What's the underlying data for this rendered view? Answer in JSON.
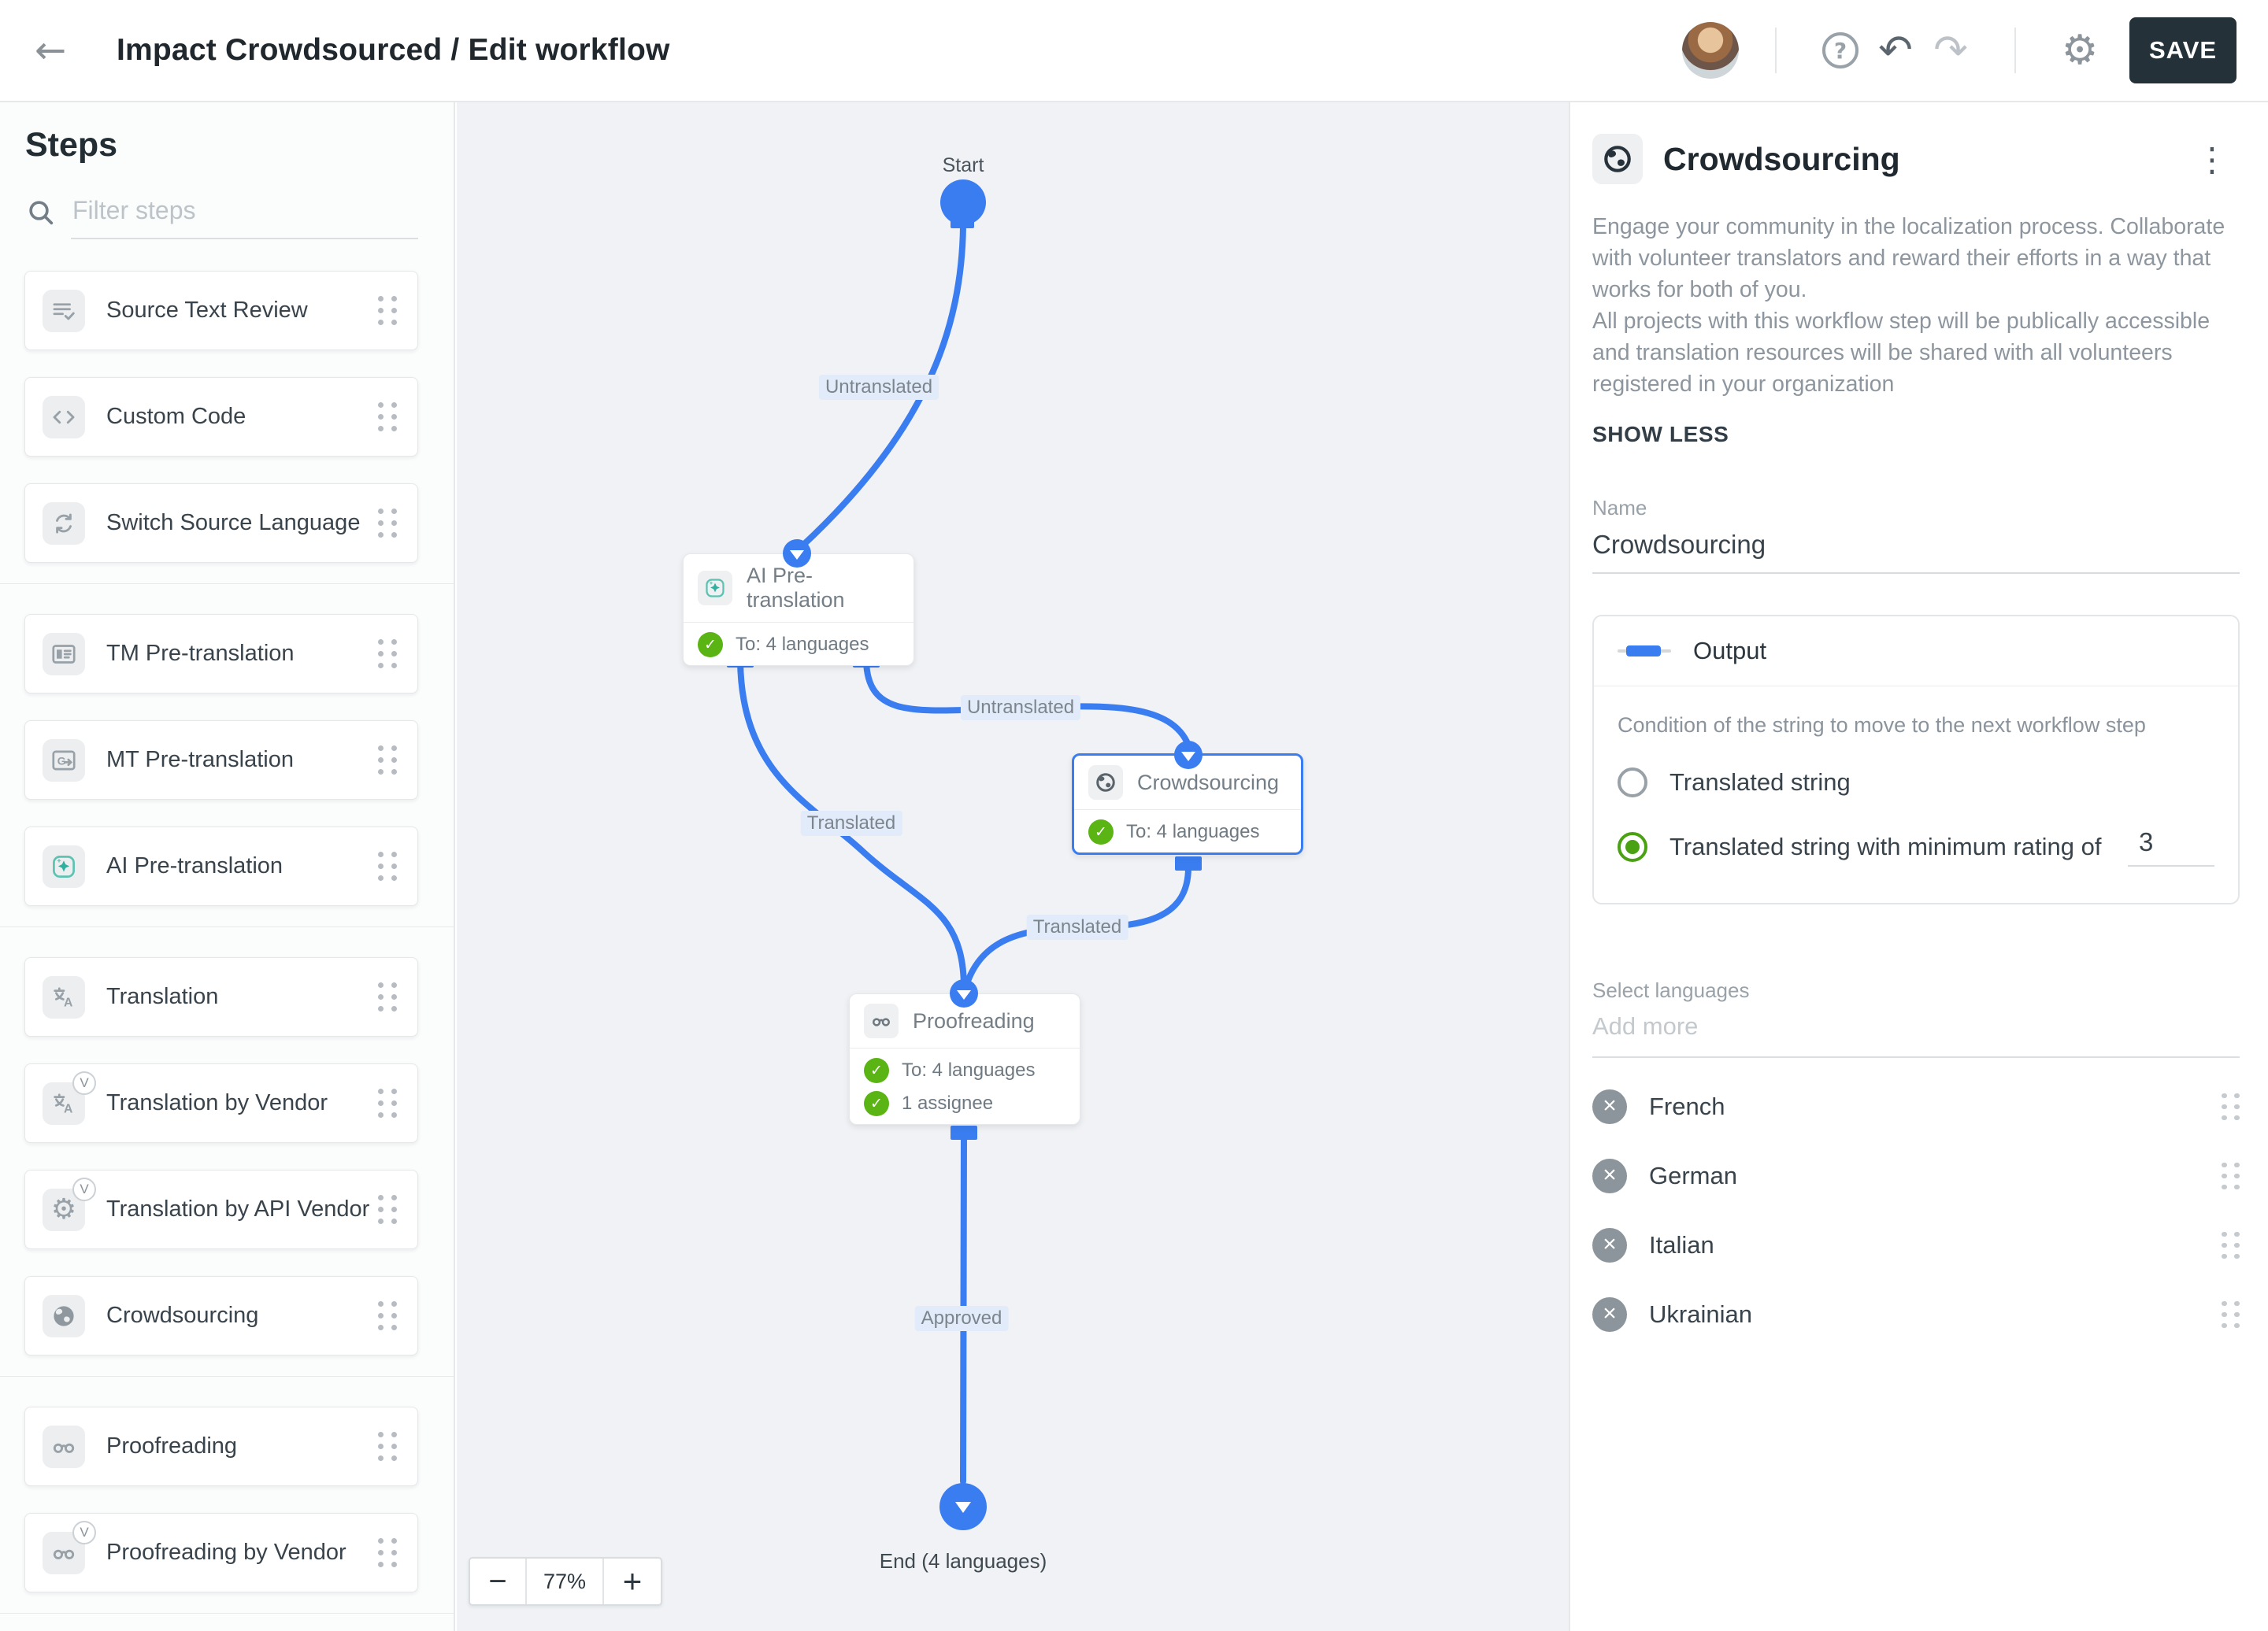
{
  "topbar": {
    "title": "Impact Crowdsourced / Edit workflow",
    "save_label": "SAVE",
    "icons": {
      "back": "back-arrow-icon",
      "avatar": "user-avatar",
      "help": "help-icon",
      "undo": "undo-icon",
      "redo": "redo-icon",
      "settings": "gear-icon"
    }
  },
  "sidebar": {
    "title": "Steps",
    "filter_placeholder": "Filter steps",
    "groups": [
      {
        "items": [
          {
            "label": "Source Text Review",
            "icon": "source-text-review-icon"
          },
          {
            "label": "Custom Code",
            "icon": "code-icon"
          },
          {
            "label": "Switch Source Language",
            "icon": "switch-language-icon"
          }
        ]
      },
      {
        "items": [
          {
            "label": "TM Pre-translation",
            "icon": "tm-pretranslation-icon"
          },
          {
            "label": "MT Pre-translation",
            "icon": "mt-pretranslation-icon"
          },
          {
            "label": "AI Pre-translation",
            "icon": "ai-sparkle-icon"
          }
        ]
      },
      {
        "items": [
          {
            "label": "Translation",
            "icon": "translate-icon"
          },
          {
            "label": "Translation by Vendor",
            "icon": "translate-icon",
            "badge": "V"
          },
          {
            "label": "Translation by API Vendor",
            "icon": "gear-icon",
            "badge": "V"
          },
          {
            "label": "Crowdsourcing",
            "icon": "globe-icon"
          }
        ]
      },
      {
        "items": [
          {
            "label": "Proofreading",
            "icon": "glasses-icon"
          },
          {
            "label": "Proofreading by Vendor",
            "icon": "glasses-icon",
            "badge": "V"
          }
        ]
      }
    ]
  },
  "canvas": {
    "zoom_out_label": "−",
    "zoom_level": "77%",
    "zoom_in_label": "+",
    "nodes": {
      "start": {
        "label": "Start"
      },
      "ai_pre_translation": {
        "title": "AI Pre-translation",
        "icon": "ai-sparkle-icon",
        "rows": [
          {
            "icon": "check-circle-icon",
            "text": "To: 4 languages"
          }
        ]
      },
      "crowdsourcing": {
        "title": "Crowdsourcing",
        "icon": "globe-icon",
        "selected": true,
        "rows": [
          {
            "icon": "check-circle-icon",
            "text": "To: 4 languages"
          }
        ]
      },
      "proofreading": {
        "title": "Proofreading",
        "icon": "glasses-icon",
        "rows": [
          {
            "icon": "check-circle-icon",
            "text": "To: 4 languages"
          },
          {
            "icon": "check-circle-icon",
            "text": "1 assignee"
          }
        ]
      },
      "end": {
        "label": "End (4 languages)"
      }
    },
    "edges": {
      "start_to_ai": "Untranslated",
      "ai_to_crowdsourcing": "Untranslated",
      "ai_to_proofreading": "Translated",
      "crowdsourcing_to_proofreading": "Translated",
      "proofreading_to_end": "Approved"
    }
  },
  "panel": {
    "icon": "globe-icon",
    "title": "Crowdsourcing",
    "menu_icon": "kebab-menu-icon",
    "description_p1": "Engage your community in the localization process. Collaborate with volunteer translators and reward their efforts in a way that works for both of you.",
    "description_p2": "All projects with this workflow step will be publically accessible and translation resources will be shared with all volunteers registered in your organization",
    "show_less_label": "SHOW LESS",
    "name_label": "Name",
    "name_value": "Crowdsourcing",
    "output": {
      "header_label": "Output",
      "condition_text": "Condition of the string to move to the next workflow step",
      "options": [
        {
          "label": "Translated string",
          "selected": false
        },
        {
          "label": "Translated string with minimum rating of",
          "selected": true,
          "value": "3"
        }
      ]
    },
    "select_languages_label": "Select languages",
    "add_more_placeholder": "Add more",
    "languages": [
      {
        "name": "French"
      },
      {
        "name": "German"
      },
      {
        "name": "Italian"
      },
      {
        "name": "Ukrainian"
      }
    ]
  },
  "colors": {
    "accent_blue": "#3a7df0",
    "success_green": "#5ab414",
    "save_button_bg": "#243139",
    "canvas_bg": "#f0f2f5",
    "selected_node_border": "#3a7df0"
  }
}
